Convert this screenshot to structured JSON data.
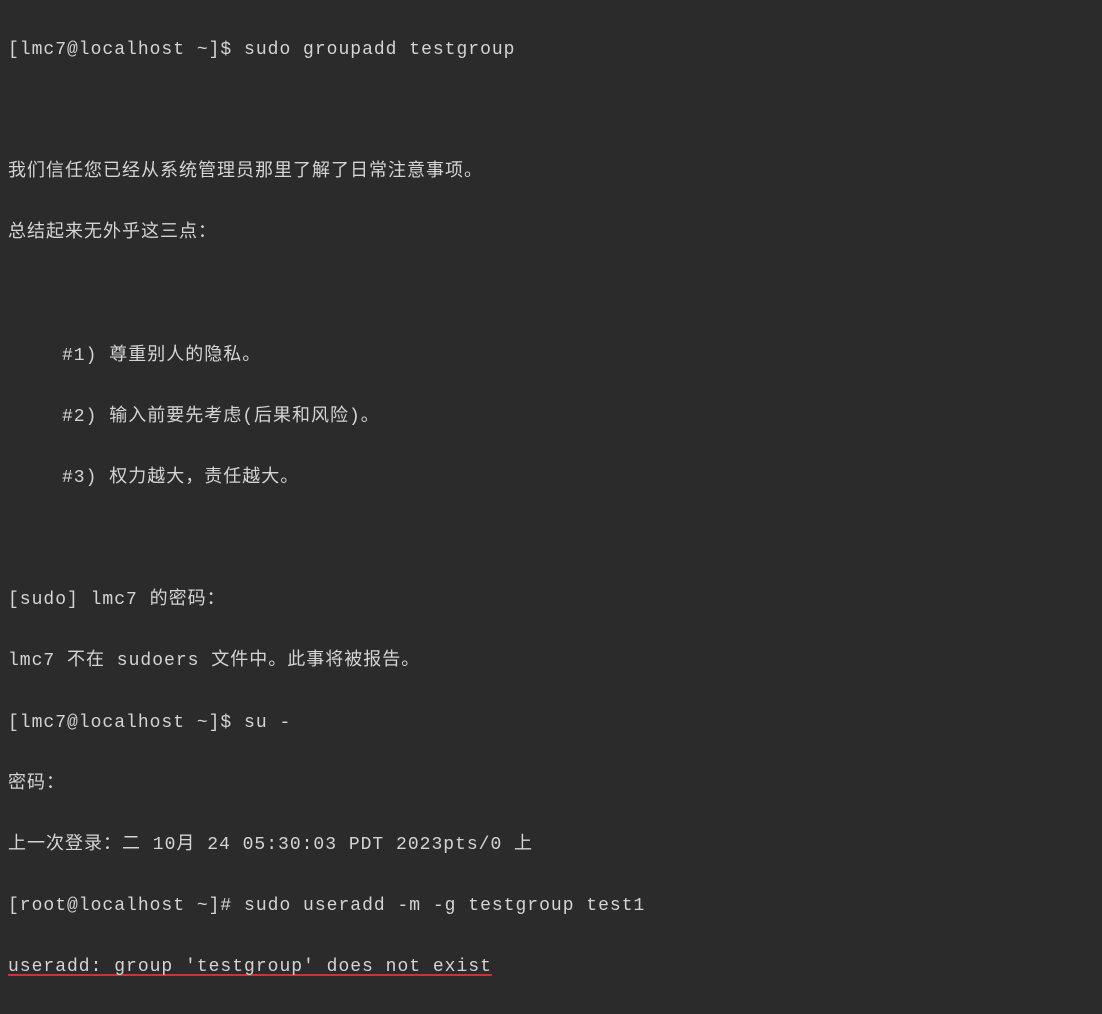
{
  "lines": {
    "l1_prompt": "[lmc7@localhost ~]$ ",
    "l1_cmd": "sudo groupadd testgroup",
    "l3": "我们信任您已经从系统管理员那里了解了日常注意事项。",
    "l4": "总结起来无外乎这三点：",
    "l6": "#1) 尊重别人的隐私。",
    "l7": "#2) 输入前要先考虑(后果和风险)。",
    "l8": "#3) 权力越大，责任越大。",
    "l10": "[sudo] lmc7 的密码：",
    "l11": "lmc7 不在 sudoers 文件中。此事将被报告。",
    "l12_prompt": "[lmc7@localhost ~]$ ",
    "l12_cmd": "su -",
    "l13": "密码：",
    "l14": "上一次登录：二 10月 24 05:30:03 PDT 2023pts/0 上",
    "l15_prompt": "[root@localhost ~]# ",
    "l15_cmd": "sudo useradd -m -g testgroup test1",
    "l16": "useradd: group 'testgroup' does not exist"
  }
}
